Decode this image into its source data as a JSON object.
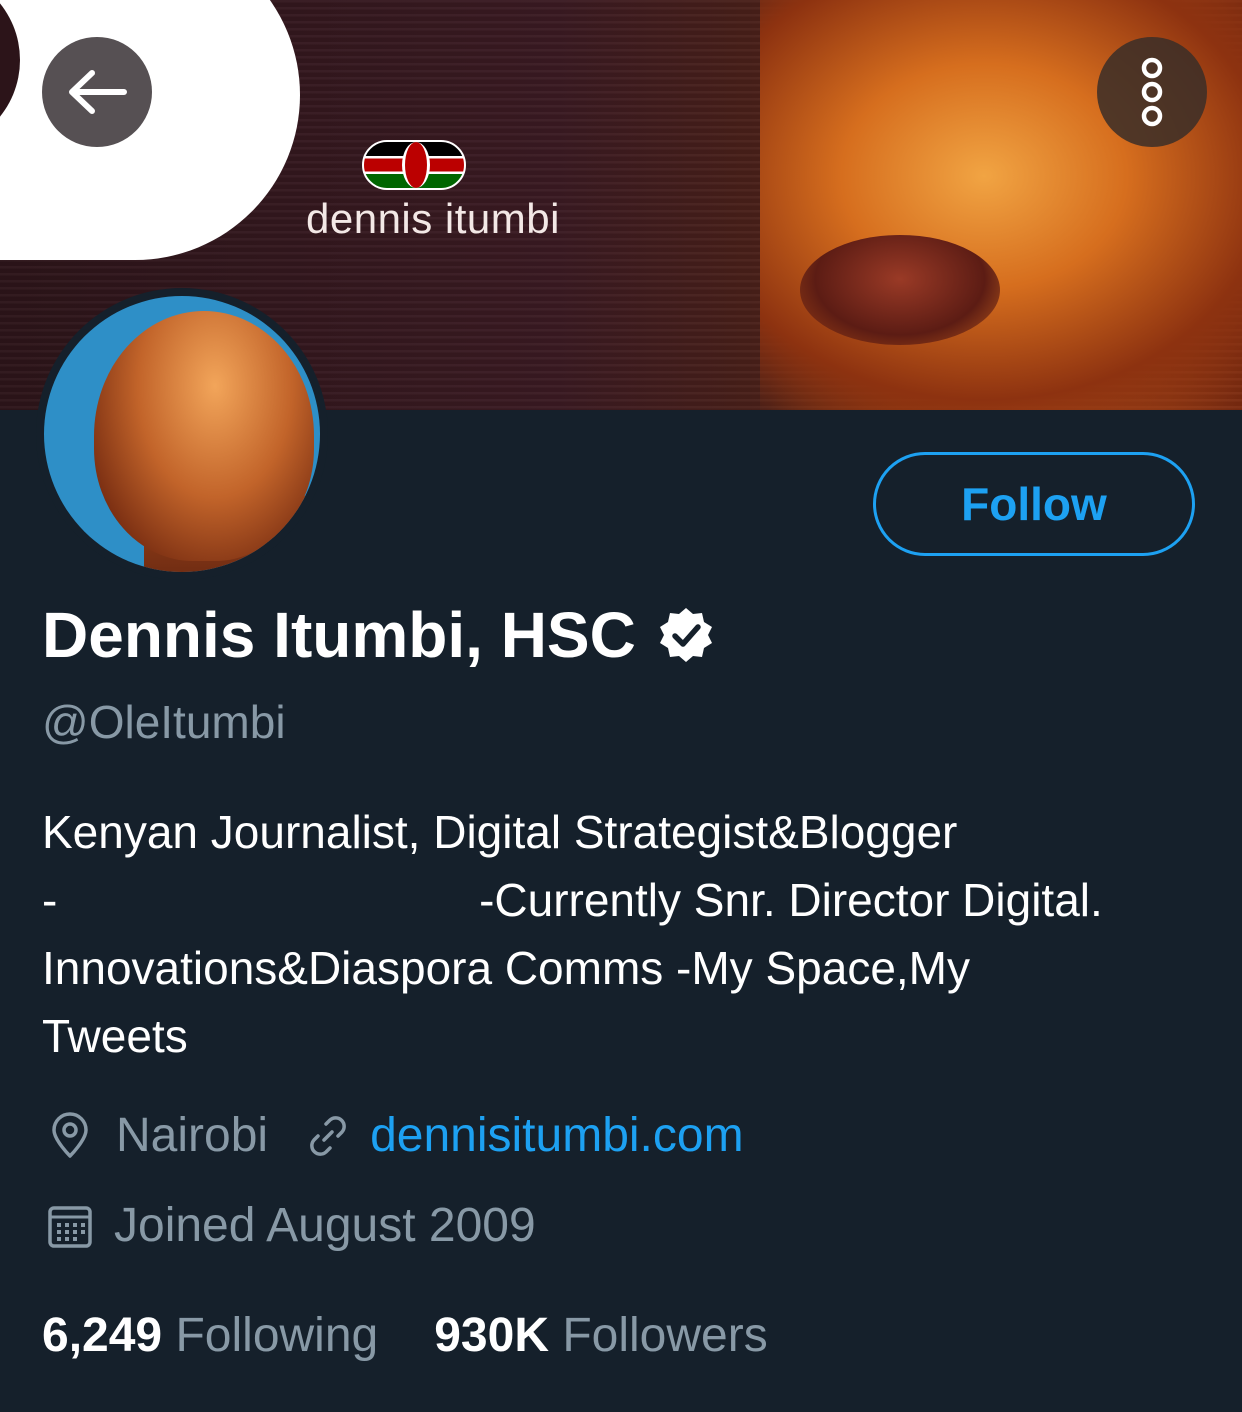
{
  "banner": {
    "caption": "dennis itumbi"
  },
  "header": {
    "back_icon": "arrow-left-icon",
    "more_icon": "more-vertical-icon"
  },
  "profile": {
    "name": "Dennis Itumbi, HSC",
    "verified": true,
    "handle": "@OleItumbi",
    "follow_label": "Follow",
    "bio_lines": [
      "Kenyan Journalist, Digital Strategist&Blogger",
      "-                                 -Currently Snr. Director Digital.",
      "Innovations&Diaspora Comms -My Space,My",
      "Tweets"
    ],
    "location": "Nairobi",
    "website": "dennisitumbi.com",
    "joined": "Joined August 2009",
    "following_count": "6,249",
    "following_label": "Following",
    "followers_count": "930K",
    "followers_label": "Followers"
  },
  "colors": {
    "background": "#15202b",
    "accent": "#1da1f2",
    "muted": "#8899a6"
  }
}
